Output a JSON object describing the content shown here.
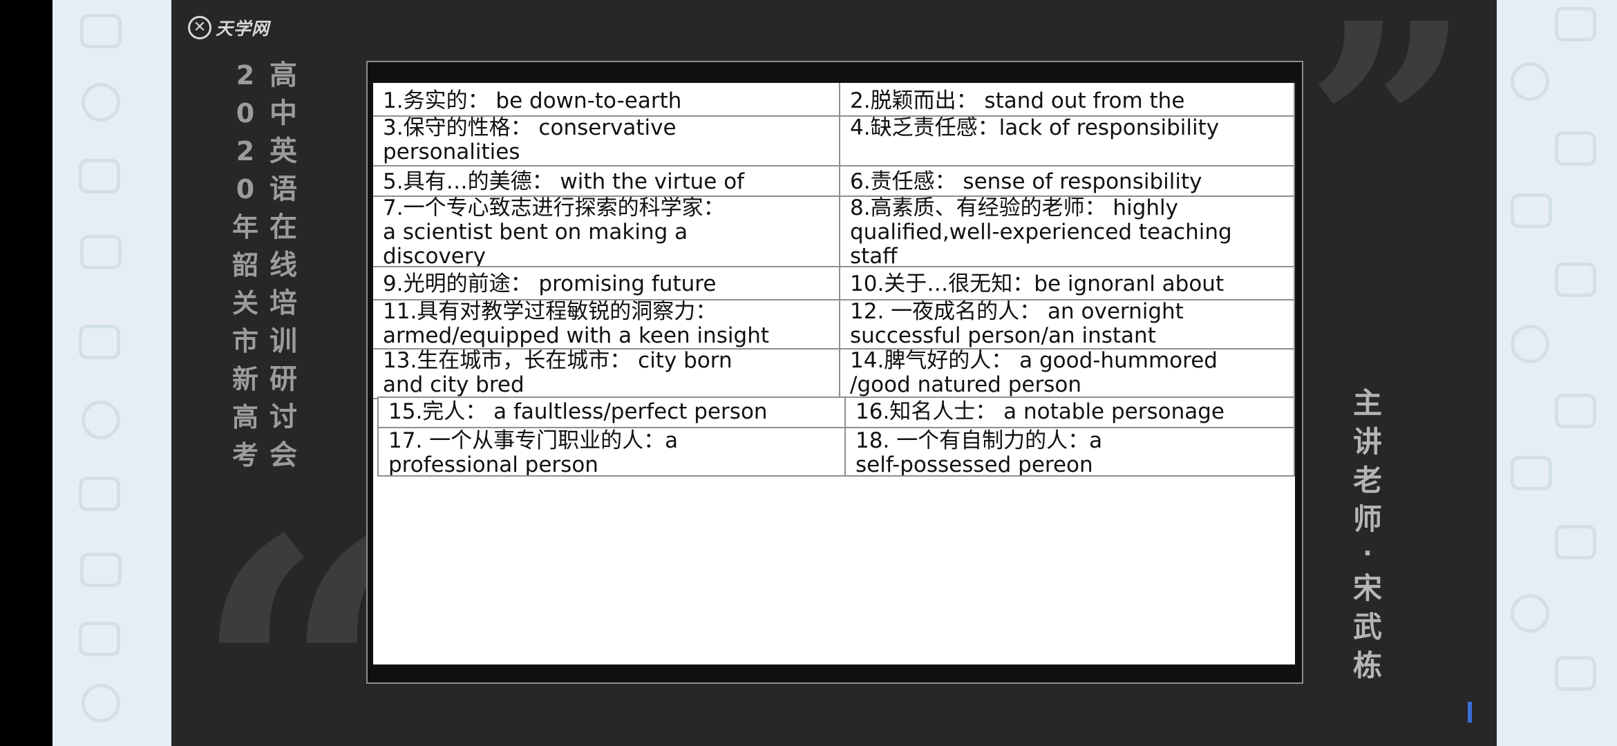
{
  "slide": {
    "logo_text": "天学网",
    "logo_mark": "✕",
    "title_chars_col1": [
      "2",
      "0",
      "2",
      "0",
      "年",
      "韶",
      "关",
      "市",
      "新",
      "高",
      "考"
    ],
    "title_chars_col2": [
      "高",
      "中",
      "英",
      "语",
      "在",
      "线",
      "培",
      "训",
      "研",
      "讨",
      "会"
    ],
    "teacher_chars": [
      "主",
      "讲",
      "老",
      "师",
      "·",
      "宋",
      "武",
      "栋"
    ],
    "open_quote": "“",
    "close_quote": "”"
  },
  "table": {
    "rows": [
      {
        "left": [
          "1.务实的： be down-to-earth"
        ],
        "right": [
          "2.脱颖而出： stand out from the"
        ]
      },
      {
        "left": [
          "3.保守的性格： conservative",
          "personalities"
        ],
        "right": [
          "4.缺乏责任感：lack of responsibility"
        ]
      },
      {
        "left": [
          "5.具有…的美德： with the virtue of"
        ],
        "right": [
          "6.责任感： sense of responsibility"
        ]
      },
      {
        "left": [
          "7.一个专心致志进行探索的科学家：",
          "a scientist bent on making a",
          "discovery"
        ],
        "right": [
          "8.高素质、有经验的老师： highly",
          "qualified,well-experienced teaching",
          "staff"
        ]
      },
      {
        "left": [
          "9.光明的前途： promising future"
        ],
        "right": [
          "10.关于…很无知：be ignoranl about"
        ]
      },
      {
        "left": [
          "11.具有对教学过程敏锐的洞察力：",
          "armed/equipped with a keen insight"
        ],
        "right": [
          "12. 一夜成名的人： an overnight",
          "successful person/an instant"
        ]
      },
      {
        "left": [
          "13.生在城市，长在城市： city born",
          "and city bred"
        ],
        "right": [
          "14.脾气好的人： a good-hummored",
          "/good natured person"
        ]
      },
      {
        "left": [
          "15.完人： a faultless/perfect person"
        ],
        "right": [
          "16.知名人士：  a notable personage"
        ]
      },
      {
        "left": [
          "17. 一个从事专门职业的人：a",
          "professional person"
        ],
        "right": [
          "18. 一个有自制力的人：a",
          "self-possessed pereon"
        ]
      }
    ]
  }
}
